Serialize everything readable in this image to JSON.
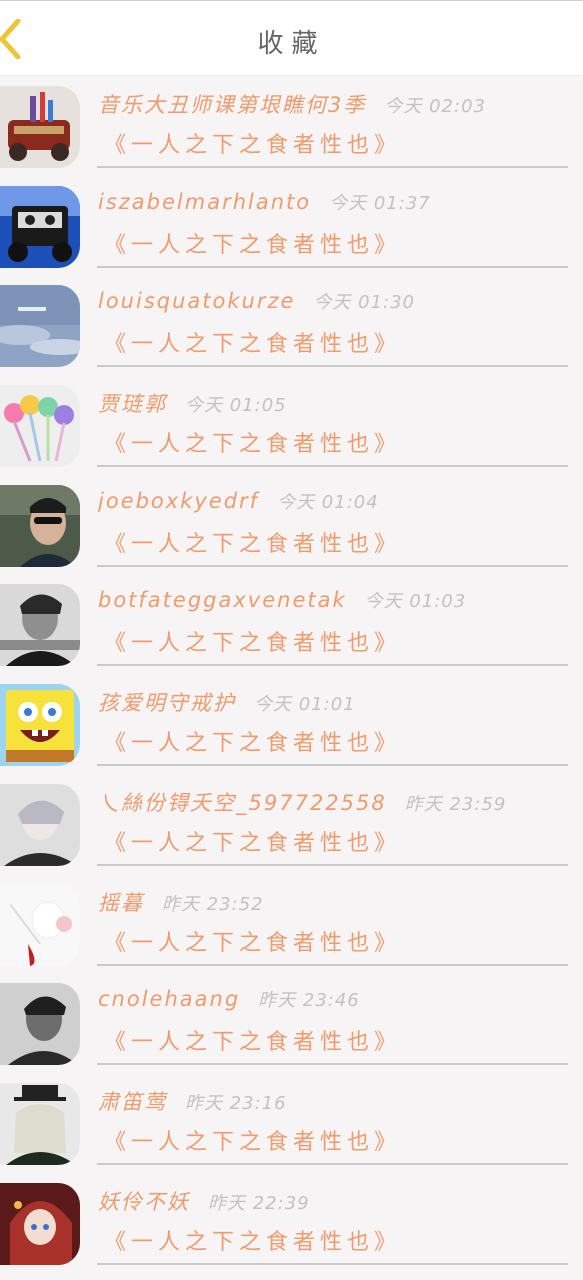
{
  "header": {
    "title": "收藏",
    "back_icon": "chevron-left-icon"
  },
  "colors": {
    "accent": "#ef9b6c",
    "back_arrow": "#f1c232",
    "time": "#c2c2c2",
    "background": "#f6f4f5"
  },
  "items": [
    {
      "name": "音乐大丑师课第垠瞧何3季",
      "time": "今天 02:03",
      "subtitle": "《一人之下之食者性也》",
      "avatar": "toy-car-avatar"
    },
    {
      "name": "iszabelmarhlanto",
      "time": "今天 01:37",
      "subtitle": "《一人之下之食者性也》",
      "avatar": "cartoon-car-avatar"
    },
    {
      "name": "louisquatokurze",
      "time": "今天 01:30",
      "subtitle": "《一人之下之食者性也》",
      "avatar": "sky-avatar"
    },
    {
      "name": "贾琏郭",
      "time": "今天 01:05",
      "subtitle": "《一人之下之食者性也》",
      "avatar": "pens-avatar"
    },
    {
      "name": "joeboxkyedrf",
      "time": "今天 01:04",
      "subtitle": "《一人之下之食者性也》",
      "avatar": "man-sunglasses-avatar"
    },
    {
      "name": "botfateggaxvenetak",
      "time": "今天 01:03",
      "subtitle": "《一人之下之食者性也》",
      "avatar": "bw-man-avatar"
    },
    {
      "name": "孩爱明守戒护",
      "time": "今天 01:01",
      "subtitle": "《一人之下之食者性也》",
      "avatar": "spongebob-avatar"
    },
    {
      "name": "乀絲份锝夭空_597722558",
      "time": "昨天 23:59",
      "subtitle": "《一人之下之食者性也》",
      "avatar": "anime-boy-avatar"
    },
    {
      "name": "摇暮",
      "time": "昨天 23:52",
      "subtitle": "《一人之下之食者性也》",
      "avatar": "white-flower-avatar"
    },
    {
      "name": "cnolehaang",
      "time": "昨天 23:46",
      "subtitle": "《一人之下之食者性也》",
      "avatar": "bw-portrait-avatar"
    },
    {
      "name": "肃笛莺",
      "time": "昨天 23:16",
      "subtitle": "《一人之下之食者性也》",
      "avatar": "anime-girl-hat-avatar"
    },
    {
      "name": "妖伶不妖",
      "time": "昨天 22:39",
      "subtitle": "《一人之下之食者性也》",
      "avatar": "anime-girl-red-avatar"
    }
  ]
}
